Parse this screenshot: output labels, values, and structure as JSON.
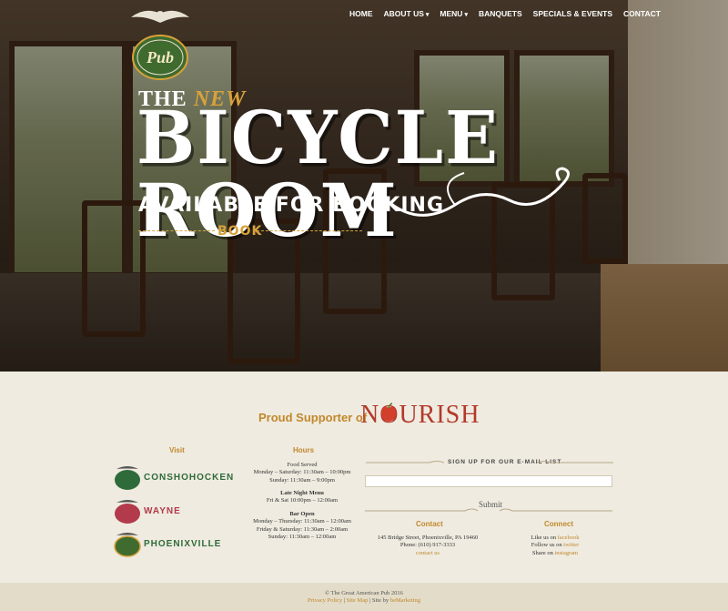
{
  "nav": {
    "items": [
      {
        "label": "HOME",
        "dropdown": false
      },
      {
        "label": "ABOUT US",
        "dropdown": true
      },
      {
        "label": "MENU",
        "dropdown": true
      },
      {
        "label": "BANQUETS",
        "dropdown": false
      },
      {
        "label": "SPECIALS & EVENTS",
        "dropdown": false
      },
      {
        "label": "CONTACT",
        "dropdown": false
      }
    ],
    "caret": "▾"
  },
  "logo": {
    "text": "Pub"
  },
  "hero": {
    "the": "THE",
    "new": "NEW",
    "title": "BICYCLE ROOM",
    "subtitle": "AVAILABLE FOR BOOKING",
    "book": "BOOK"
  },
  "nourish": {
    "proud": "Proud Supporter of",
    "brand": "NOURISH"
  },
  "visit": {
    "title": "Visit",
    "locations": [
      {
        "name": "CONSHOHOCKEN",
        "color": "#2f6b3a"
      },
      {
        "name": "WAYNE",
        "color": "#b23a4a"
      },
      {
        "name": "PHOENIXVILLE",
        "color": "#2f6b3a"
      }
    ]
  },
  "hours": {
    "title": "Hours",
    "food_title": "Food Served",
    "food_1": "Monday – Saturday: 11:30am – 10:00pm",
    "food_2": "Sunday: 11:30am – 9:00pm",
    "late_title": "Late Night Menu",
    "late_1": "Fri & Sat 10:00pm – 12:00am",
    "bar_title": "Bar Open",
    "bar_1": "Monday – Thursday: 11:30am – 12:00am",
    "bar_2": "Friday & Saturday: 11:30am – 2:00am",
    "bar_3": "Sunday: 11:30am – 12:00am"
  },
  "mailing": {
    "label": "SIGN UP FOR OUR E-MAIL LIST",
    "submit": "Submit"
  },
  "contact": {
    "title": "Contact",
    "address": "145 Bridge Street, Phoenixville, PA 19460",
    "phone": "Phone: (610) 917-3333",
    "link": "contact us"
  },
  "connect": {
    "title": "Connect",
    "like_prefix": "Like us on ",
    "like_link": "facebook",
    "follow_prefix": "Follow us on ",
    "follow_link": "twitter",
    "share_prefix": "Share on ",
    "share_link": "instagram"
  },
  "copyright": {
    "line1": "© The Great American Pub 2016",
    "privacy": "Privacy Policy",
    "sitemap": "Site Map",
    "site_by_prefix": "Site by ",
    "site_by_link": "beMarketing"
  },
  "colors": {
    "gold": "#c1882c",
    "accent": "#d8a23a",
    "nourish_red": "#b23a2b"
  }
}
